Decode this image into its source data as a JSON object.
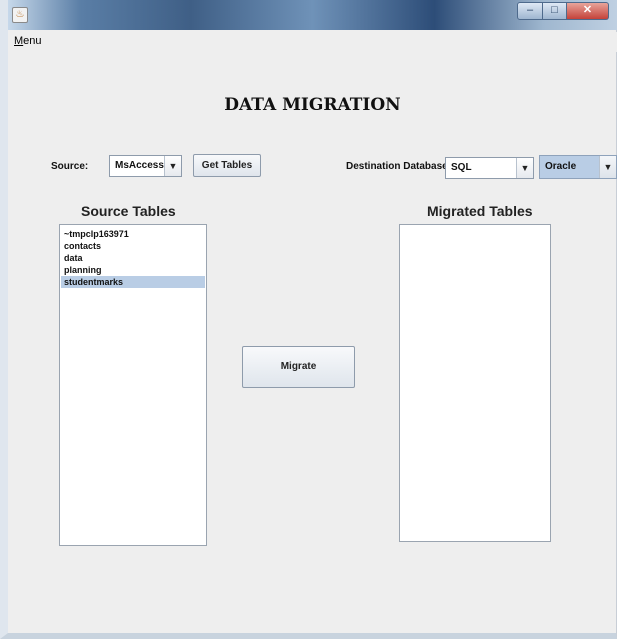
{
  "menu": {
    "label_first": "M",
    "label_rest": "enu"
  },
  "title": "DATA MIGRATION",
  "source": {
    "label": "Source:",
    "value": "MsAccess",
    "get_tables_label": "Get Tables"
  },
  "destination": {
    "label": "Destination Database:",
    "value1": "SQL",
    "value2": "Oracle"
  },
  "source_tables": {
    "heading": "Source Tables",
    "items": [
      {
        "label": "~tmpclp163971",
        "selected": false
      },
      {
        "label": "contacts",
        "selected": false
      },
      {
        "label": "data",
        "selected": false
      },
      {
        "label": "planning",
        "selected": false
      },
      {
        "label": "studentmarks",
        "selected": true
      }
    ]
  },
  "migrated_tables": {
    "heading": "Migrated Tables",
    "items": []
  },
  "migrate_label": "Migrate",
  "icons": {
    "app": "java-cup-icon",
    "minimize": "minimize-icon",
    "maximize": "maximize-icon",
    "close": "close-icon",
    "dropdown": "chevron-down-icon"
  }
}
